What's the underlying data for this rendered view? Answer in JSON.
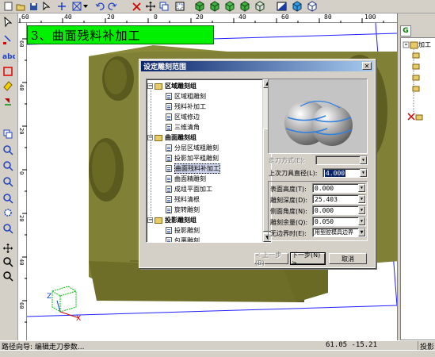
{
  "toolbar": {
    "icons": [
      "new-icon",
      "open-icon",
      "save-icon",
      "select-icon",
      "box-icon",
      "undo-icon",
      "redo-icon",
      "delete-icon",
      "move-icon",
      "copy-icon",
      "view-icon",
      "cube-front-icon",
      "cube-top-icon",
      "cube-side-icon",
      "cube-iso-icon",
      "render-icon",
      "layer-icon",
      "shade-icon"
    ]
  },
  "ruler": {
    "h_ticks": [
      "60",
      "40",
      "20",
      "0",
      "20",
      "40",
      "60",
      "80",
      "100"
    ],
    "v_ticks": [
      "60",
      "40",
      "20",
      "0",
      "20",
      "40",
      "60"
    ]
  },
  "canvas": {
    "banner": "3、曲面残料补加工",
    "axis_x": "X",
    "axis_z": "Z"
  },
  "dialog": {
    "title": "设定雕刻范围",
    "tree": {
      "groups": [
        {
          "label": "区域雕刻组",
          "items": [
            "区域粗雕刻",
            "残料补加工",
            "区域修边",
            "三维清角"
          ]
        },
        {
          "label": "曲面雕刻组",
          "items": [
            "分层区域粗雕刻",
            "投影加平粗雕刻",
            "曲面残料补加工",
            "曲面精雕刻",
            "成组平面加工",
            "残料清根",
            "旋转雕刻"
          ]
        },
        {
          "label": "投影雕刻组",
          "items": [
            "投影雕刻",
            "包裹雕刻"
          ]
        }
      ],
      "selected": "曲面残料补加工"
    },
    "tool_mode": {
      "label": "走刀方式(E):",
      "value": ""
    },
    "prev_tool": {
      "label": "上次刀具直径(L):",
      "value": "4.000"
    },
    "params": [
      {
        "label": "表面高度(T):",
        "value": "0.000"
      },
      {
        "label": "雕刻深度(D):",
        "value": "25.403"
      },
      {
        "label": "侧面角度(N):",
        "value": "0.000"
      },
      {
        "label": "雕刻余量(Q):",
        "value": "0.050"
      },
      {
        "label": "无边界时(E):",
        "value": "用型腔模具边界"
      }
    ],
    "buttons": {
      "back": "< 上一步(B)",
      "next": "下一步(N) >",
      "cancel": "取消"
    }
  },
  "right_panel": {
    "tab": "G",
    "tree_label": "加工"
  },
  "status": {
    "left": "路径向导: 编辑走刀参数...",
    "coords": "61.05  -15.21",
    "right": "投影"
  },
  "colors": {
    "banner_bg": "#00f000",
    "part_olive": "#8a8a3a",
    "title_blue": "#0a246a"
  }
}
